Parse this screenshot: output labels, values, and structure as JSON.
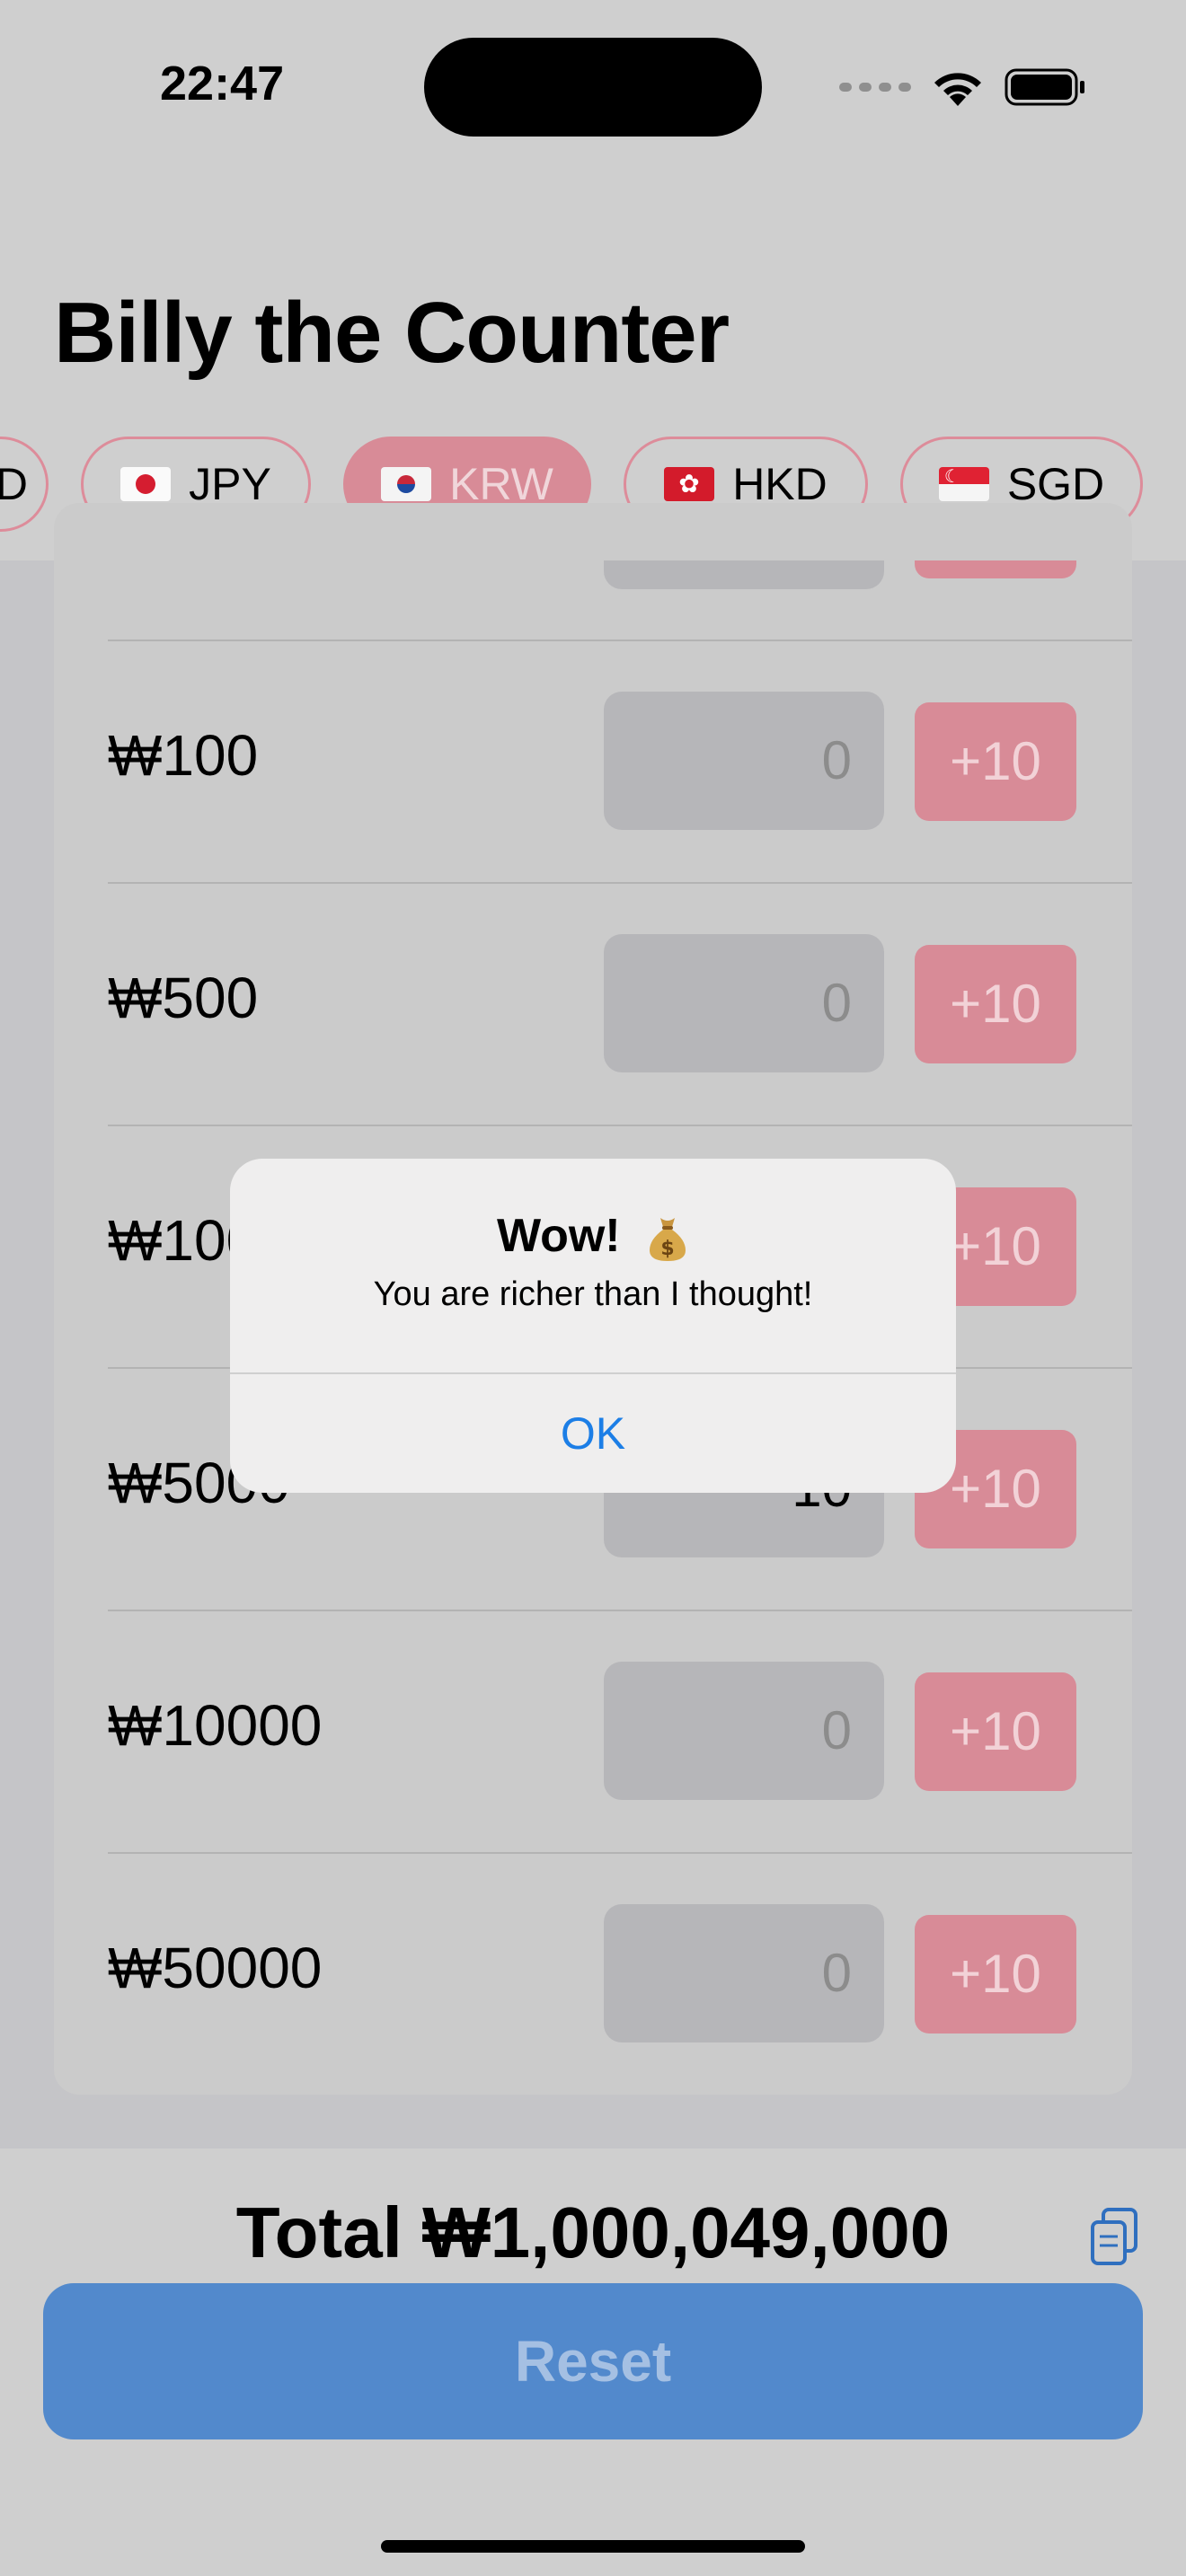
{
  "status_bar": {
    "time": "22:47"
  },
  "app": {
    "title": "Billy the Counter"
  },
  "currency_chips": [
    {
      "code": "D",
      "flag": "none",
      "selected": false
    },
    {
      "code": "JPY",
      "flag": "japan-flag-icon",
      "selected": false
    },
    {
      "code": "KRW",
      "flag": "south-korea-flag-icon",
      "selected": true
    },
    {
      "code": "HKD",
      "flag": "hong-kong-flag-icon",
      "selected": false
    },
    {
      "code": "SGD",
      "flag": "singapore-flag-icon",
      "selected": false
    }
  ],
  "rows": [
    {
      "label": "₩100",
      "value": "0",
      "button": "+10"
    },
    {
      "label": "₩500",
      "value": "0",
      "button": "+10"
    },
    {
      "label": "₩1000",
      "value": "0",
      "button": "+10"
    },
    {
      "label": "₩5000",
      "value": "10",
      "button": "+10"
    },
    {
      "label": "₩10000",
      "value": "0",
      "button": "+10"
    },
    {
      "label": "₩50000",
      "value": "0",
      "button": "+10"
    }
  ],
  "footer": {
    "total": "Total ₩1,000,049,000",
    "reset_label": "Reset"
  },
  "alert": {
    "title": "Wow!",
    "message": "You are richer than I thought!",
    "ok_label": "OK"
  },
  "colors": {
    "accent_pink": "#d88b97",
    "reset_blue": "#5289cc",
    "alert_link": "#1c7ee6"
  }
}
